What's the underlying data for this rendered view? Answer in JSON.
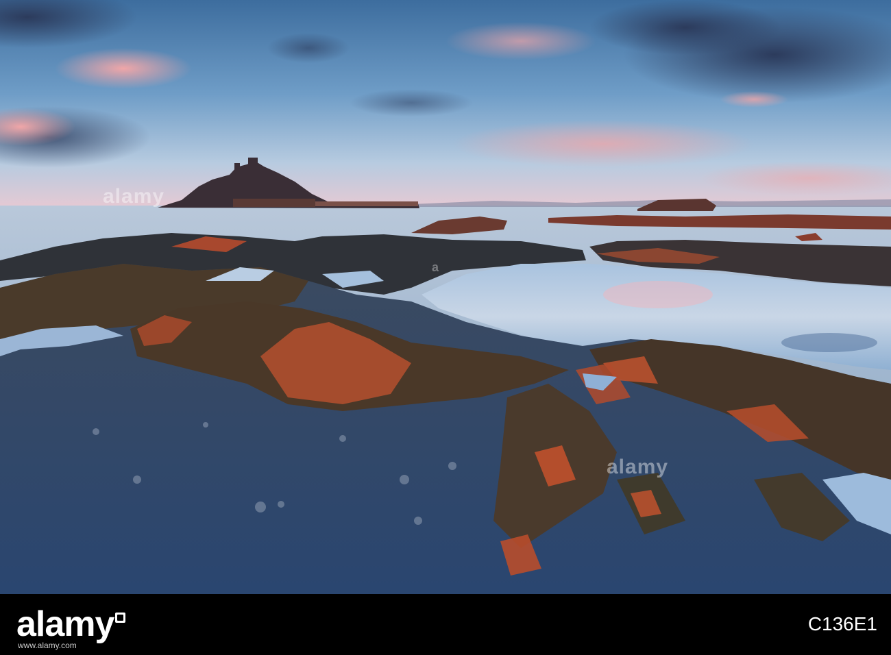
{
  "photo": {
    "description_key": "seascape-rockpools-island-castle"
  },
  "watermarks": {
    "primary": "alamy",
    "secondary": "alamy",
    "tertiary": "a"
  },
  "footer": {
    "logo": "alamy",
    "image_id": "C136E1",
    "url": "www.alamy.com"
  },
  "colors": {
    "sky_top": "#3f6e9e",
    "sky_horizon": "#e9c4cf",
    "sea": "#a9bfd6",
    "rock_dark": "#2f3540",
    "weed_orange": "#c2492a",
    "footer_bg": "#000000"
  }
}
